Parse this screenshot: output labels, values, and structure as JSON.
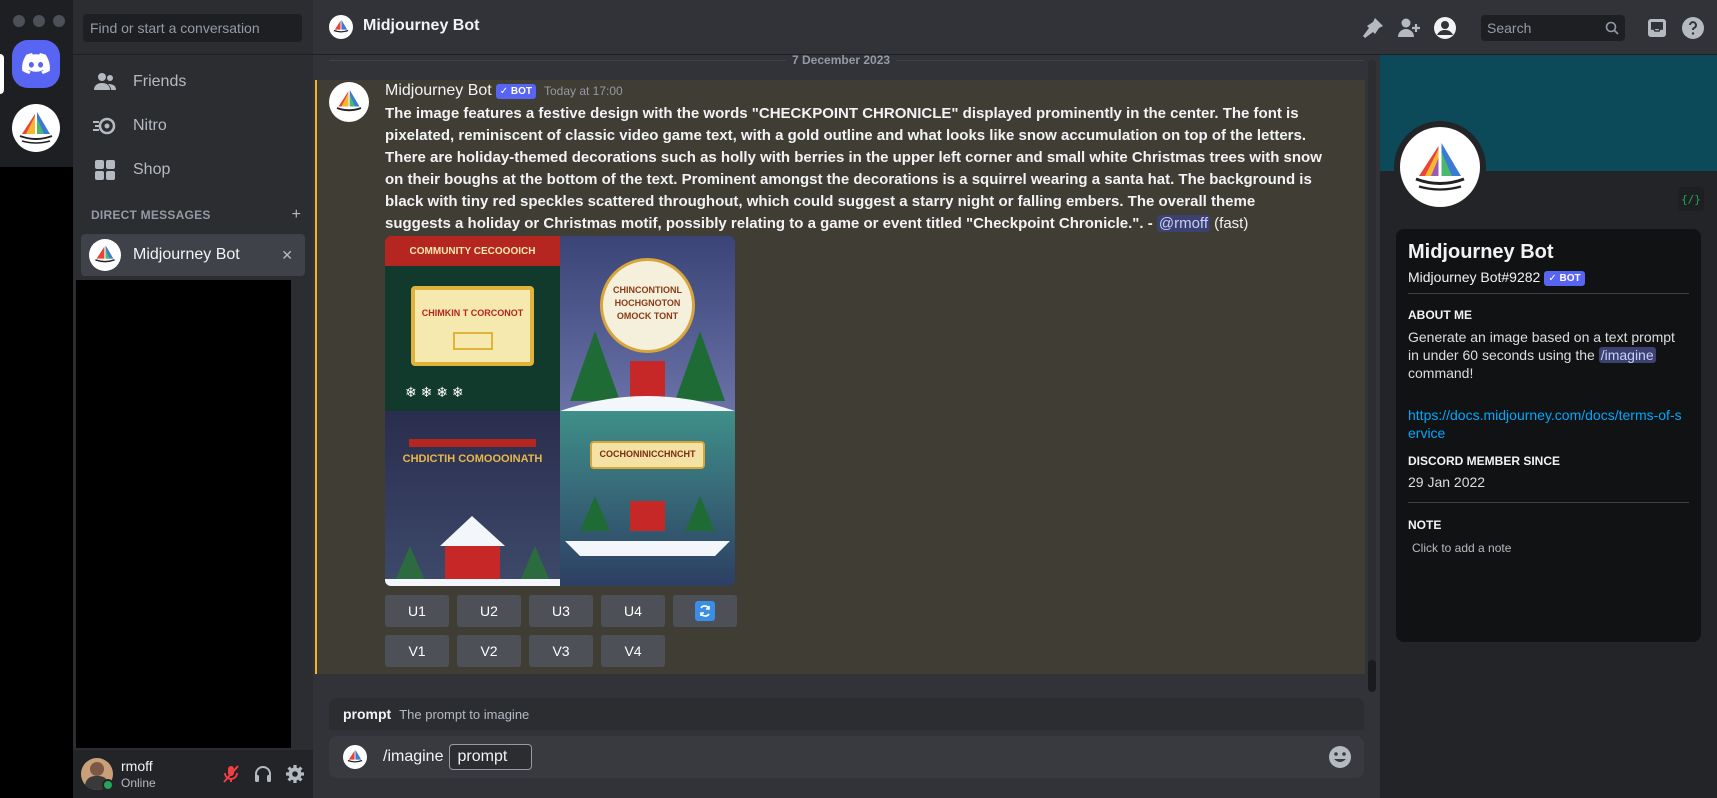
{
  "sidebar": {
    "search_placeholder": "Find or start a conversation",
    "nav": [
      {
        "label": "Friends",
        "icon": "friends-icon"
      },
      {
        "label": "Nitro",
        "icon": "nitro-icon"
      },
      {
        "label": "Shop",
        "icon": "shop-icon"
      }
    ],
    "dm_header": "DIRECT MESSAGES",
    "dm_add": "+",
    "dm_items": [
      {
        "label": "Midjourney Bot",
        "close": "✕"
      }
    ]
  },
  "user": {
    "name": "rmoff",
    "status": "Online"
  },
  "topbar": {
    "channel": "Midjourney Bot",
    "search_placeholder": "Search"
  },
  "chat": {
    "date_divider": "7 December 2023",
    "message": {
      "author": "Midjourney Bot",
      "badge": "✓ BOT",
      "time": "Today at 17:00",
      "text": "The image features a festive design with the words \"CHECKPOINT CHRONICLE\" displayed prominently in the center. The font is pixelated, reminiscent of classic video game text, with a gold outline and what looks like snow accumulation on top of the letters. There are holiday-themed decorations such as holly with berries in the upper left corner and small white Christmas trees with snow on their boughs at the bottom of the text. Prominent amongst the decorations is a squirrel wearing a santa hat. The background is black with tiny red speckles scattered throughout, which could suggest a starry night or falling embers. The overall theme suggests a holiday or Christmas motif, possibly relating to a game or event titled \"Checkpoint Chronicle.\". - ",
      "mention": "@rmoff",
      "suffix": " (fast)",
      "tiles": [
        {
          "title": "CHIMKIN T CORCONOT",
          "banner": "COMMUNITY CECOOOICH",
          "bg": "#123a2c",
          "accent": "#f5e9b0"
        },
        {
          "title": "CHINCONTIONL HOCHGNOTON OMOCK TONT",
          "bg": "#3a4476",
          "accent": "#f5f0dc"
        },
        {
          "title": "CHDICTIH COMOOOINATH",
          "bg": "#2a2d4e",
          "accent": "#e8b84a"
        },
        {
          "title": "COCHONINICCHNCHT",
          "bg": "#3f8f8a",
          "accent": "#f3e2a4"
        }
      ],
      "buttons_row1": [
        "U1",
        "U2",
        "U3",
        "U4"
      ],
      "buttons_row2": [
        "V1",
        "V2",
        "V3",
        "V4"
      ],
      "reroll_icon": "refresh-icon"
    }
  },
  "composer": {
    "option_name": "prompt",
    "option_desc": "The prompt to imagine",
    "command": "/imagine",
    "chip": "prompt"
  },
  "profile": {
    "name": "Midjourney Bot",
    "tag": "Midjourney Bot#9282",
    "badge": "✓ BOT",
    "about_label": "ABOUT ME",
    "about_text_1": "Generate an image based on a text prompt in under 60 seconds using the ",
    "about_cmd": "/imagine",
    "about_text_2": " command!",
    "link": "https://docs.midjourney.com/docs/terms-of-service",
    "member_label": "DISCORD MEMBER SINCE",
    "member_date": "29 Jan 2022",
    "note_label": "NOTE",
    "note_placeholder": "Click to add a note"
  },
  "colors": {
    "brand": "#5865f2",
    "highlight_border": "#f0b232",
    "link": "#00a8fc"
  }
}
